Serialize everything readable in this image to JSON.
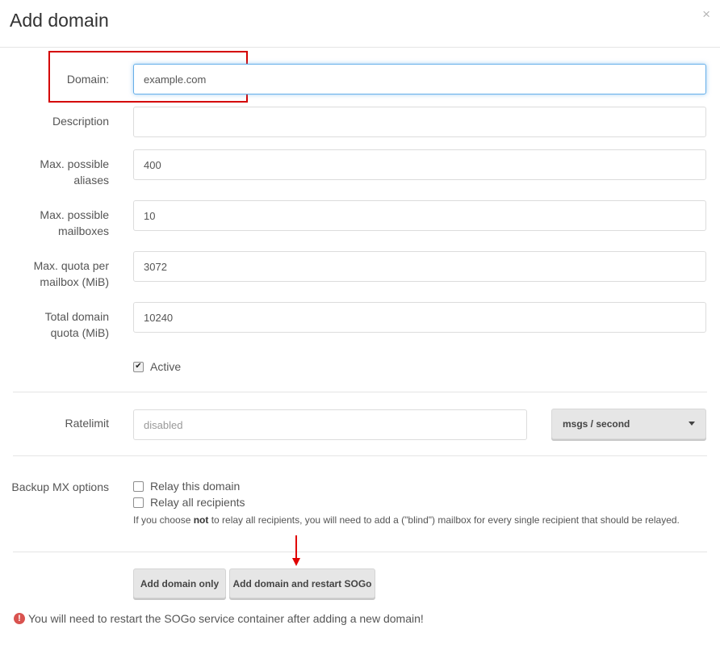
{
  "header": {
    "title": "Add domain",
    "close_glyph": "×"
  },
  "fields": {
    "domain": {
      "label": "Domain:",
      "value": "example.com"
    },
    "description": {
      "label": "Description",
      "value": ""
    },
    "aliases": {
      "label_line1": "Max. possible",
      "label_line2": "aliases",
      "value": "400"
    },
    "mailboxes": {
      "label_line1": "Max. possible",
      "label_line2": "mailboxes",
      "value": "10"
    },
    "quota": {
      "label_line1": "Max. quota per",
      "label_line2": "mailbox (MiB)",
      "value": "3072"
    },
    "total": {
      "label_line1": "Total domain",
      "label_line2": "quota (MiB)",
      "value": "10240"
    }
  },
  "active": {
    "label": "Active",
    "checked": true
  },
  "ratelimit": {
    "label": "Ratelimit",
    "placeholder": "disabled",
    "unit": "msgs / second"
  },
  "backup": {
    "label": "Backup MX options",
    "relay_domain": "Relay this domain",
    "relay_all": "Relay all recipients",
    "help_pre": "If you choose ",
    "help_bold": "not",
    "help_post": " to relay all recipients, you will need to add a (\"blind\") mailbox for every single recipient that should be relayed."
  },
  "buttons": {
    "add_only": "Add domain only",
    "add_restart": "Add domain and restart SOGo"
  },
  "warning": {
    "icon": "!",
    "text": "You will need to restart the SOGo service container after adding a new domain!"
  },
  "colors": {
    "annotation": "#d40000",
    "focus": "#66afe9",
    "danger": "#d9534f"
  }
}
